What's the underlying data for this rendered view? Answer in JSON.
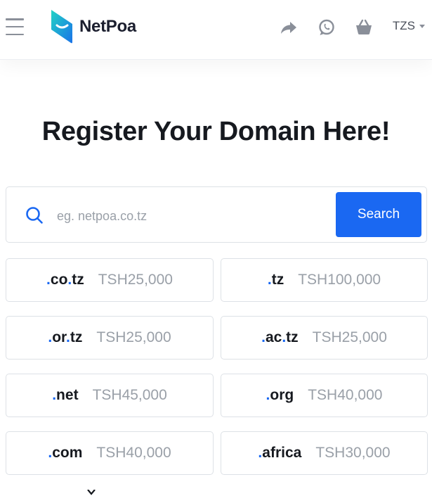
{
  "header": {
    "brand": "NetPoa",
    "currency": "TZS",
    "icons": [
      "menu-icon",
      "netpoa-logo-icon",
      "share-icon",
      "whatsapp-icon",
      "basket-icon",
      "chevron-down-icon"
    ]
  },
  "main": {
    "title": "Register Your Domain Here!",
    "search": {
      "placeholder": "eg. netpoa.co.tz",
      "value": "",
      "button_label": "Search"
    },
    "tlds": [
      {
        "ext": ".co.tz",
        "price": "TSH25,000"
      },
      {
        "ext": ".tz",
        "price": "TSH100,000"
      },
      {
        "ext": ".or.tz",
        "price": "TSH25,000"
      },
      {
        "ext": ".ac.tz",
        "price": "TSH25,000"
      },
      {
        "ext": ".net",
        "price": "TSH45,000"
      },
      {
        "ext": ".org",
        "price": "TSH40,000"
      },
      {
        "ext": ".com",
        "price": "TSH40,000"
      },
      {
        "ext": ".africa",
        "price": "TSH30,000"
      }
    ]
  },
  "colors": {
    "accent": "#1a68f2",
    "logo_gradient": [
      "#1fc7c4",
      "#1a73e8"
    ],
    "muted_icon": "#8a8f99",
    "price_text": "#9aa0a8"
  }
}
